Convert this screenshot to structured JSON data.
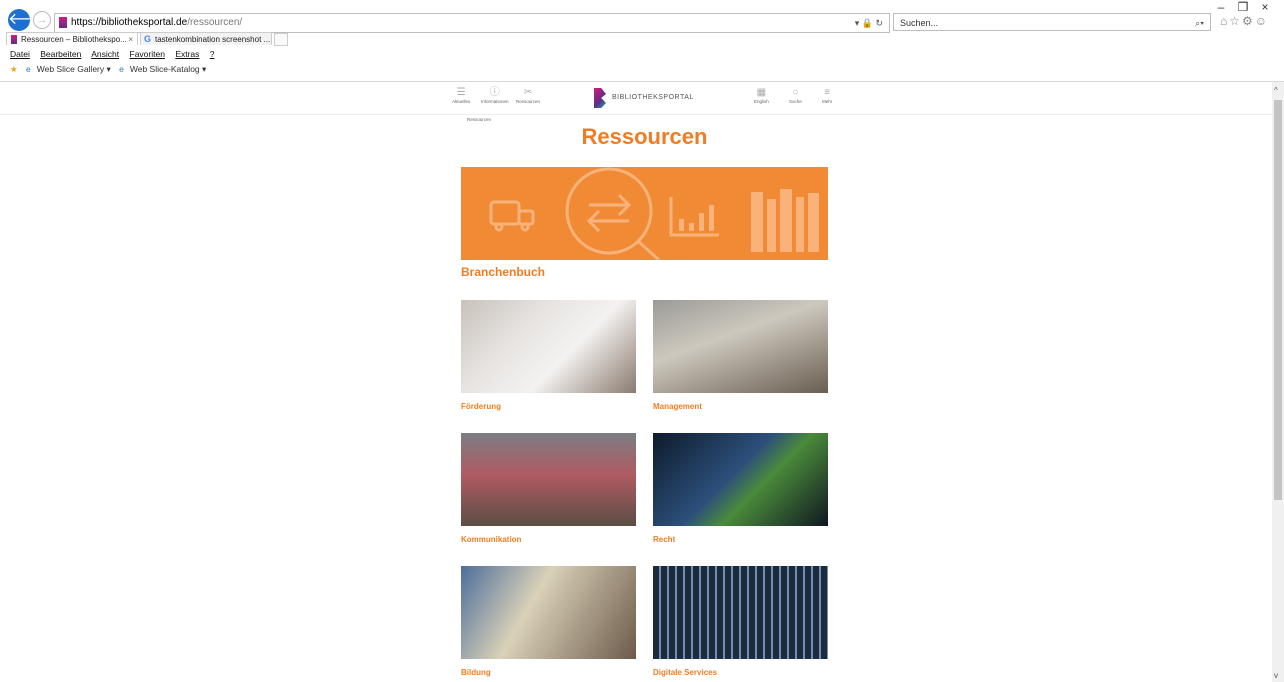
{
  "browser": {
    "url_main": "https://bibliotheksportal.de",
    "url_path": "/ressourcen/",
    "search_placeholder": "Suchen...",
    "tabs": [
      {
        "label": "Ressourcen – Bibliothekspo...",
        "close": "×"
      },
      {
        "label": "tastenkombination screenshot ..."
      }
    ],
    "menu": [
      "Datei",
      "Bearbeiten",
      "Ansicht",
      "Favoriten",
      "Extras",
      "?"
    ],
    "favorites": [
      "Web Slice Gallery ▾",
      "Web Slice-Katalog ▾"
    ],
    "window_controls": [
      "–",
      "❐",
      "×"
    ]
  },
  "site": {
    "nav_left": [
      {
        "label": "Aktuelles",
        "icon": "menu-lines-icon"
      },
      {
        "label": "Informationen",
        "icon": "info-icon"
      },
      {
        "label": "Ressourcen",
        "icon": "tools-icon"
      }
    ],
    "logo_text": "BIBLIOTHEKSPORTAL",
    "nav_right": [
      {
        "label": "English",
        "icon": "flag-icon"
      },
      {
        "label": "Suche",
        "icon": "search-icon"
      },
      {
        "label": "Mehr",
        "icon": "hamburger-icon"
      }
    ],
    "breadcrumb": "Ressourcen"
  },
  "page": {
    "title": "Ressourcen",
    "section": "Branchenbuch",
    "cards": [
      {
        "label": "Förderung"
      },
      {
        "label": "Management"
      },
      {
        "label": "Kommunikation"
      },
      {
        "label": "Recht"
      },
      {
        "label": "Bildung"
      },
      {
        "label": "Digitale Services"
      }
    ]
  },
  "colors": {
    "accent": "#f07d24",
    "banner": "#f08a35",
    "browser_blue": "#1f6fd1"
  }
}
